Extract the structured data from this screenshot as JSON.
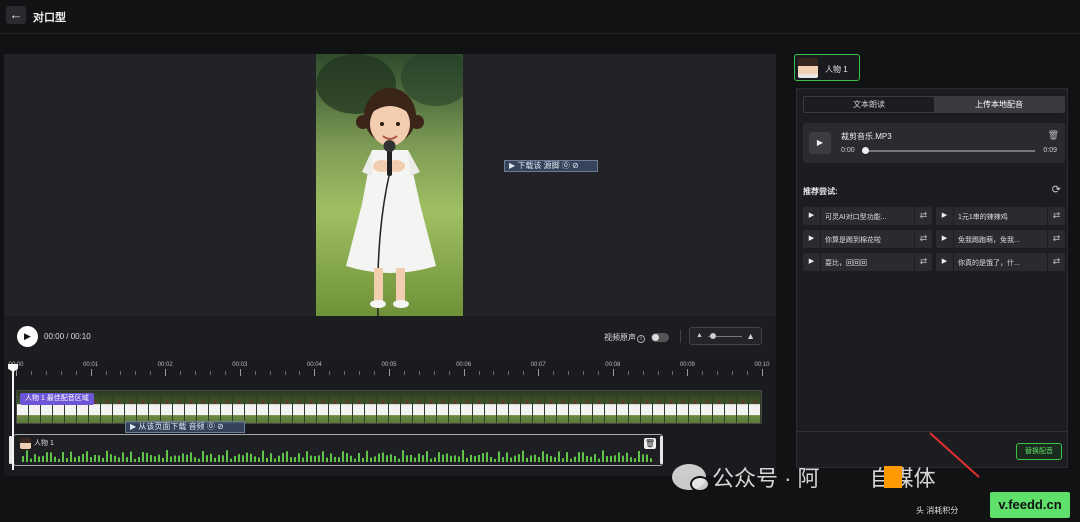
{
  "header": {
    "back_icon": "←",
    "title": "对口型"
  },
  "preview": {
    "watermark_small": "▶ 下载该 源脚 ⓪ ⊘"
  },
  "player": {
    "play_icon": "▶",
    "time": "00:00 / 00:10",
    "original_audio_label": "视频原声",
    "info_icon": "i"
  },
  "timeline": {
    "ticks": [
      "00:00",
      "00:01",
      "00:02",
      "00:03",
      "00:04",
      "00:05",
      "00:06",
      "00:07",
      "00:08",
      "00:09",
      "00:10"
    ],
    "best_area_label": "人物 1 最佳配音区域",
    "watermark": "▶ 从该页面下载 音频 ⓪ ⊘",
    "audio_track_label": "人物 1",
    "trash_icon": "🗑"
  },
  "character": {
    "name": "人物 1"
  },
  "panel": {
    "tabs": [
      {
        "label": "文本朗读",
        "active": false
      },
      {
        "label": "上传本地配音",
        "active": true
      }
    ],
    "audio_file": {
      "play_icon": "▶",
      "name": "裁剪音乐.MP3",
      "start": "0:00",
      "end": "0:09",
      "trash_icon": "🗑",
      "progress": 0.0
    },
    "recommend_label": "推荐尝试:",
    "refresh_icon": "⟳",
    "suggestions": [
      "可灵AI对口型功能...",
      "1元1串的辣辣鸡",
      "你算是踢到棉花啦",
      "免我踢跑萌，免我...",
      "耍比，回回回",
      "你真的是饿了，什..."
    ],
    "swap_icon": "⇄",
    "replace_button": "替换配音"
  },
  "overlay": {
    "watermark_text": "公众号 · 阿",
    "watermark_tail": "自媒体",
    "site_logo": "v.feedd.cn",
    "bottom_text": "头   消耗积分"
  }
}
